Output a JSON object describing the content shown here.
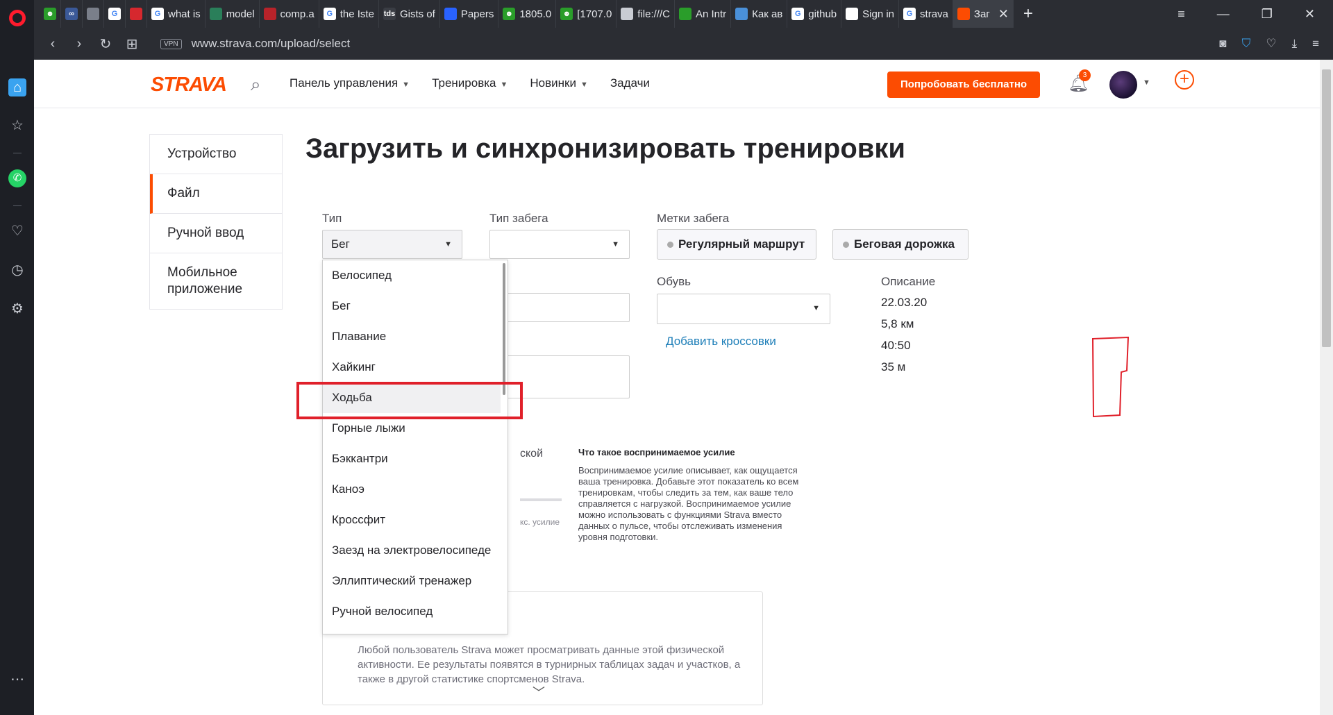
{
  "browser": {
    "tabs": [
      {
        "label": "",
        "color": "#2a9d2a",
        "glyph": "☻"
      },
      {
        "label": "",
        "color": "#3b5998",
        "glyph": "∞"
      },
      {
        "label": "",
        "color": "#7a7f8a",
        "glyph": ""
      },
      {
        "label": "",
        "color": "#ffffff",
        "glyph": "G"
      },
      {
        "label": "",
        "color": "#d6282e",
        "glyph": ""
      },
      {
        "label": "what is",
        "color": "#ffffff",
        "glyph": "G"
      },
      {
        "label": "model",
        "color": "#2a7f5a",
        "glyph": ""
      },
      {
        "label": "comp.a",
        "color": "#b8232a",
        "glyph": ""
      },
      {
        "label": "the Iste",
        "color": "#ffffff",
        "glyph": "G"
      },
      {
        "label": "Gists of",
        "color": "#3a3d44",
        "glyph": "tds"
      },
      {
        "label": "Papers",
        "color": "#2962ff",
        "glyph": ""
      },
      {
        "label": "1805.0",
        "color": "#2a9d2a",
        "glyph": "☻"
      },
      {
        "label": "[1707.0",
        "color": "#2a9d2a",
        "glyph": "☻"
      },
      {
        "label": "file:///C",
        "color": "#c9ccd3",
        "glyph": ""
      },
      {
        "label": "An Intr",
        "color": "#2a9d2a",
        "glyph": ""
      },
      {
        "label": "Как ав",
        "color": "#4a90d9",
        "glyph": ""
      },
      {
        "label": "github",
        "color": "#ffffff",
        "glyph": "G"
      },
      {
        "label": "Sign in",
        "color": "#ffffff",
        "glyph": ""
      },
      {
        "label": "strava",
        "color": "#ffffff",
        "glyph": "G"
      },
      {
        "label": "Заг",
        "color": "#fc4c02",
        "glyph": ""
      }
    ],
    "url": "www.strava.com/upload/select",
    "vpn": "VPN"
  },
  "header": {
    "logo": "STRAVA",
    "nav": [
      "Панель управления",
      "Тренировка",
      "Новинки",
      "Задачи"
    ],
    "try_button": "Попробовать бесплатно",
    "notifications": "3"
  },
  "leftmenu": [
    "Устройство",
    "Файл",
    "Ручной ввод",
    "Мобильное приложение"
  ],
  "title": "Загрузить и синхронизировать тренировки",
  "form": {
    "type_label": "Тип",
    "type_value": "Бег",
    "run_type_label": "Тип забега",
    "run_tags_label": "Метки забега",
    "tag1": "Регулярный маршрут",
    "tag2": "Беговая дорожка",
    "shoes_label": "Обувь",
    "add_shoes": "Добавить кроссовки",
    "description_label": "Описание",
    "description_lines": [
      "22.03.20",
      "5,8 км",
      "40:50",
      "35 м"
    ]
  },
  "effort": {
    "partial_label": "ской",
    "partial_small": "кс. усилие",
    "title": "Что такое воспринимаемое усилие",
    "text": "Воспринимаемое усилие описывает, как ощущается ваша тренировка. Добавьте этот показатель ко всем тренировкам, чтобы следить за тем, как ваше тело справляется с нагрузкой. Воспринимаемое усилие можно использовать с функциями Strava вместо данных о пульсе, чтобы отслеживать изменения уровня подготовки."
  },
  "privacy": {
    "text": "Любой пользователь Strava может просматривать данные этой физической активности. Ее результаты появятся в турнирных таблицах задач и участков, а также в другой статистике спортсменов Strava."
  },
  "dropdown": {
    "items": [
      "Велосипед",
      "Бег",
      "Плавание",
      "Хайкинг",
      "Ходьба",
      "Горные лыжи",
      "Бэккантри",
      "Каноэ",
      "Кроссфит",
      "Заезд на электровелосипеде",
      "Эллиптический тренажер",
      "Ручной велосипед"
    ],
    "highlighted_index": 4
  },
  "colors": {
    "accent": "#fc4c02",
    "annotation": "#e0202a"
  }
}
